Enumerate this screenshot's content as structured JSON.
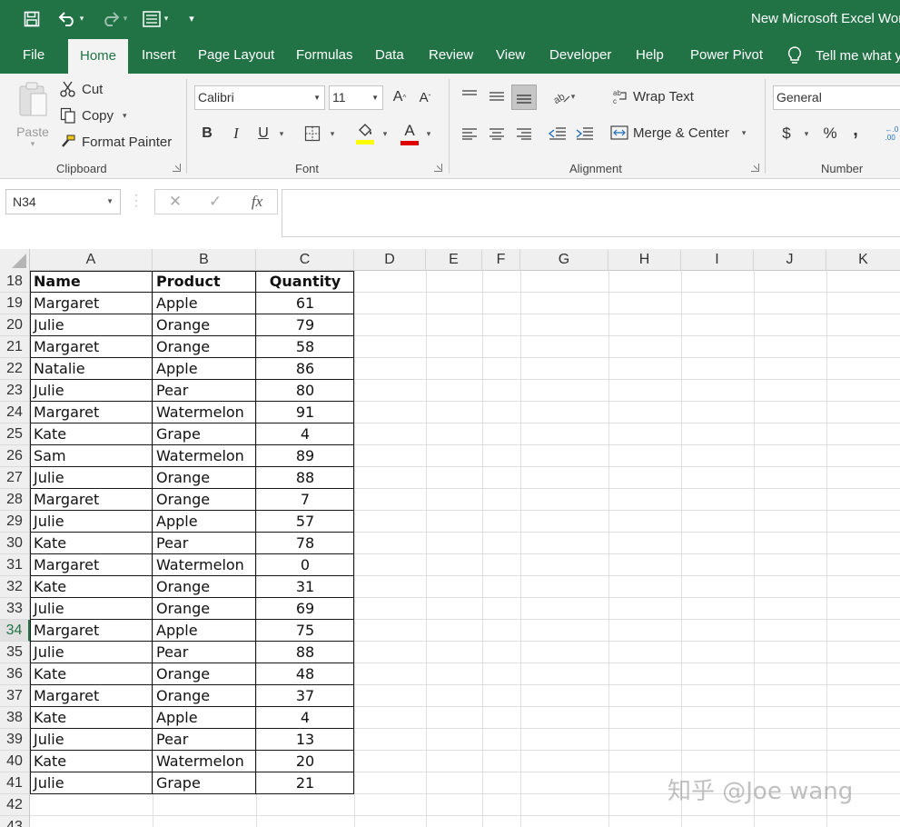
{
  "window": {
    "title": "New Microsoft Excel Wor"
  },
  "colors": {
    "brand": "#217346",
    "ribbon_bg": "#f3f3f3"
  },
  "qat": {
    "save_icon": "save-icon",
    "undo_icon": "undo-icon",
    "redo_icon": "redo-icon",
    "form_icon": "form-icon",
    "customize_icon": "customize-icon"
  },
  "tabs": [
    {
      "label": "File"
    },
    {
      "label": "Home",
      "active": true
    },
    {
      "label": "Insert"
    },
    {
      "label": "Page Layout"
    },
    {
      "label": "Formulas"
    },
    {
      "label": "Data"
    },
    {
      "label": "Review"
    },
    {
      "label": "View"
    },
    {
      "label": "Developer"
    },
    {
      "label": "Help"
    },
    {
      "label": "Power Pivot"
    }
  ],
  "tell_me": "Tell me what y",
  "ribbon": {
    "clipboard": {
      "label": "Clipboard",
      "paste": "Paste",
      "cut": "Cut",
      "copy": "Copy",
      "format_painter": "Format Painter"
    },
    "font": {
      "label": "Font",
      "font_name": "Calibri",
      "font_size": "11",
      "bold": "B",
      "italic": "I",
      "underline": "U",
      "font_color_letter": "A"
    },
    "alignment": {
      "label": "Alignment",
      "wrap_text": "Wrap Text",
      "merge_center": "Merge & Center"
    },
    "number": {
      "label": "Number",
      "format": "General",
      "currency": "$",
      "percent": "%",
      "comma": ","
    }
  },
  "formula_bar": {
    "name_box": "N34",
    "cancel": "✕",
    "enter": "✓",
    "fx": "fx",
    "formula": ""
  },
  "sheet": {
    "columns": [
      "A",
      "B",
      "C",
      "D",
      "E",
      "F",
      "G",
      "H",
      "I",
      "J",
      "K"
    ],
    "selected_row": "34",
    "header_row": {
      "row": "18",
      "cells": [
        "Name",
        "Product",
        "Quantity"
      ]
    },
    "rows": [
      {
        "row": "19",
        "cells": [
          "Margaret",
          "Apple",
          "61"
        ]
      },
      {
        "row": "20",
        "cells": [
          "Julie",
          "Orange",
          "79"
        ]
      },
      {
        "row": "21",
        "cells": [
          "Margaret",
          "Orange",
          "58"
        ]
      },
      {
        "row": "22",
        "cells": [
          "Natalie",
          "Apple",
          "86"
        ]
      },
      {
        "row": "23",
        "cells": [
          "Julie",
          "Pear",
          "80"
        ]
      },
      {
        "row": "24",
        "cells": [
          "Margaret",
          "Watermelon",
          "91"
        ]
      },
      {
        "row": "25",
        "cells": [
          "Kate",
          "Grape",
          "4"
        ]
      },
      {
        "row": "26",
        "cells": [
          "Sam",
          "Watermelon",
          "89"
        ]
      },
      {
        "row": "27",
        "cells": [
          "Julie",
          "Orange",
          "88"
        ]
      },
      {
        "row": "28",
        "cells": [
          "Margaret",
          "Orange",
          "7"
        ]
      },
      {
        "row": "29",
        "cells": [
          "Julie",
          "Apple",
          "57"
        ]
      },
      {
        "row": "30",
        "cells": [
          "Kate",
          "Pear",
          "78"
        ]
      },
      {
        "row": "31",
        "cells": [
          "Margaret",
          "Watermelon",
          "0"
        ]
      },
      {
        "row": "32",
        "cells": [
          "Kate",
          "Orange",
          "31"
        ]
      },
      {
        "row": "33",
        "cells": [
          "Julie",
          "Orange",
          "69"
        ]
      },
      {
        "row": "34",
        "cells": [
          "Margaret",
          "Apple",
          "75"
        ]
      },
      {
        "row": "35",
        "cells": [
          "Julie",
          "Pear",
          "88"
        ]
      },
      {
        "row": "36",
        "cells": [
          "Kate",
          "Orange",
          "48"
        ]
      },
      {
        "row": "37",
        "cells": [
          "Margaret",
          "Orange",
          "37"
        ]
      },
      {
        "row": "38",
        "cells": [
          "Kate",
          "Apple",
          "4"
        ]
      },
      {
        "row": "39",
        "cells": [
          "Julie",
          "Pear",
          "13"
        ]
      },
      {
        "row": "40",
        "cells": [
          "Kate",
          "Watermelon",
          "20"
        ]
      },
      {
        "row": "41",
        "cells": [
          "Julie",
          "Grape",
          "21"
        ]
      }
    ],
    "empty_rows": [
      "42",
      "43"
    ]
  },
  "watermark": "知乎 @Joe wang"
}
